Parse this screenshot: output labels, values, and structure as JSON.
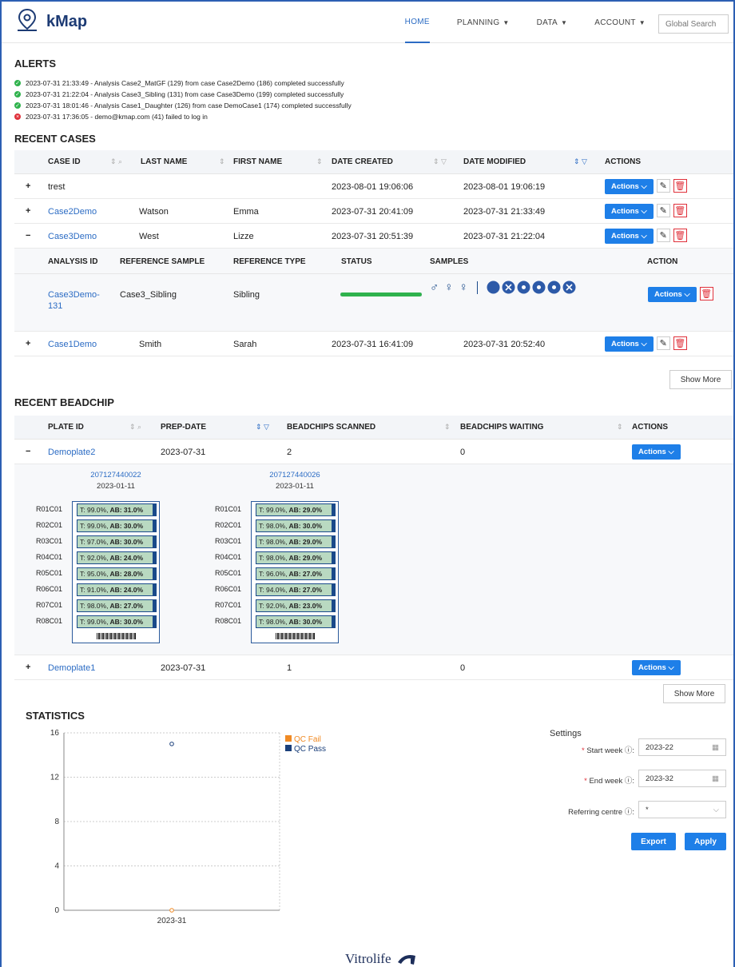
{
  "nav": {
    "app_name": "kMap",
    "links": [
      {
        "label": "HOME",
        "active": true,
        "dropdown": false
      },
      {
        "label": "PLANNING",
        "active": false,
        "dropdown": true
      },
      {
        "label": "DATA",
        "active": false,
        "dropdown": true
      },
      {
        "label": "ACCOUNT",
        "active": false,
        "dropdown": true
      }
    ],
    "search_placeholder": "Global Search"
  },
  "alerts": {
    "title": "ALERTS",
    "items": [
      {
        "status": "success",
        "text": "2023-07-31 21:33:49 - Analysis Case2_MatGF (129) from case Case2Demo (186) completed successfully"
      },
      {
        "status": "success",
        "text": "2023-07-31 21:22:04 - Analysis Case3_Sibling (131) from case Case3Demo (199) completed successfully"
      },
      {
        "status": "success",
        "text": "2023-07-31 18:01:46 - Analysis Case1_Daughter (126) from case DemoCase1 (174) completed successfully"
      },
      {
        "status": "error",
        "text": "2023-07-31 17:36:05 - demo@kmap.com (41) failed to log in"
      }
    ]
  },
  "recent_cases": {
    "title": "RECENT CASES",
    "headers": [
      "CASE ID",
      "LAST NAME",
      "FIRST NAME",
      "DATE CREATED",
      "DATE MODIFIED",
      "ACTIONS"
    ],
    "rows": [
      {
        "toggle": "+",
        "case_id": "trest",
        "last": "",
        "first": "",
        "created": "2023-08-01 19:06:06",
        "modified": "2023-08-01 19:06:19"
      },
      {
        "toggle": "+",
        "case_id": "Case2Demo",
        "last": "Watson",
        "first": "Emma",
        "created": "2023-07-31 20:41:09",
        "modified": "2023-07-31 21:33:49"
      },
      {
        "toggle": "−",
        "case_id": "Case3Demo",
        "last": "West",
        "first": "Lizze",
        "created": "2023-07-31 20:51:39",
        "modified": "2023-07-31 21:22:04"
      },
      {
        "toggle": "+",
        "case_id": "Case1Demo",
        "last": "Smith",
        "first": "Sarah",
        "created": "2023-07-31 16:41:09",
        "modified": "2023-07-31 20:52:40"
      }
    ],
    "actions_label": "Actions",
    "sub": {
      "headers": [
        "ANALYSIS ID",
        "REFERENCE SAMPLE",
        "REFERENCE TYPE",
        "STATUS",
        "SAMPLES",
        "ACTION"
      ],
      "row": {
        "analysis_id_1": "Case3Demo-",
        "analysis_id_2": "131",
        "ref_sample": "Case3_Sibling",
        "ref_type": "Sibling",
        "progress": 1.0
      }
    },
    "show_more": "Show More"
  },
  "recent_beadchip": {
    "title": "RECENT BEADCHIP",
    "headers": [
      "PLATE ID",
      "PREP-DATE",
      "BEADCHIPS SCANNED",
      "BEADCHIPS WAITING",
      "ACTIONS"
    ],
    "rows": [
      {
        "toggle": "−",
        "plate_id": "Demoplate2",
        "prep": "2023-07-31",
        "scanned": "2",
        "waiting": "0"
      },
      {
        "toggle": "+",
        "plate_id": "Demoplate1",
        "prep": "2023-07-31",
        "scanned": "1",
        "waiting": "0"
      }
    ],
    "chips": [
      {
        "id": "207127440022",
        "date": "2023-01-11",
        "rows": [
          {
            "label": "R01C01",
            "t": "T: 99.0%,",
            "ab": "AB: 31.0%"
          },
          {
            "label": "R02C01",
            "t": "T: 99.0%,",
            "ab": "AB: 30.0%"
          },
          {
            "label": "R03C01",
            "t": "T: 97.0%,",
            "ab": "AB: 30.0%"
          },
          {
            "label": "R04C01",
            "t": "T: 92.0%,",
            "ab": "AB: 24.0%"
          },
          {
            "label": "R05C01",
            "t": "T: 95.0%,",
            "ab": "AB: 28.0%"
          },
          {
            "label": "R06C01",
            "t": "T: 91.0%,",
            "ab": "AB: 24.0%"
          },
          {
            "label": "R07C01",
            "t": "T: 98.0%,",
            "ab": "AB: 27.0%"
          },
          {
            "label": "R08C01",
            "t": "T: 99.0%,",
            "ab": "AB: 30.0%"
          }
        ]
      },
      {
        "id": "207127440026",
        "date": "2023-01-11",
        "rows": [
          {
            "label": "R01C01",
            "t": "T: 99.0%,",
            "ab": "AB: 29.0%"
          },
          {
            "label": "R02C01",
            "t": "T: 98.0%,",
            "ab": "AB: 30.0%"
          },
          {
            "label": "R03C01",
            "t": "T: 98.0%,",
            "ab": "AB: 29.0%"
          },
          {
            "label": "R04C01",
            "t": "T: 98.0%,",
            "ab": "AB: 29.0%"
          },
          {
            "label": "R05C01",
            "t": "T: 96.0%,",
            "ab": "AB: 27.0%"
          },
          {
            "label": "R06C01",
            "t": "T: 94.0%,",
            "ab": "AB: 27.0%"
          },
          {
            "label": "R07C01",
            "t": "T: 92.0%,",
            "ab": "AB: 23.0%"
          },
          {
            "label": "R08C01",
            "t": "T: 98.0%,",
            "ab": "AB: 30.0%"
          }
        ]
      }
    ],
    "actions_label": "Actions",
    "show_more": "Show More"
  },
  "statistics": {
    "title": "STATISTICS",
    "settings": {
      "title": "Settings",
      "start_week_label": "Start week",
      "start_week": "2023-22",
      "end_week_label": "End week",
      "end_week": "2023-32",
      "centre_label": "Referring centre",
      "centre": "*",
      "export": "Export",
      "apply": "Apply"
    }
  },
  "chart_data": {
    "type": "scatter",
    "categories": [
      "2023-31"
    ],
    "series": [
      {
        "name": "QC Fail",
        "color": "#f08a24",
        "values": [
          0
        ]
      },
      {
        "name": "QC Pass",
        "color": "#1a3f7a",
        "values": [
          15
        ]
      }
    ],
    "yticks": [
      0,
      4,
      8,
      12,
      16
    ],
    "ylim": [
      0,
      16
    ],
    "grid": true,
    "legend": "top-right"
  },
  "footer": {
    "brand": "Vitrolife"
  },
  "colors": {
    "accent": "#1e7fe8",
    "brand": "#1d3b74",
    "success": "#2fb24c",
    "error": "#e0303a"
  }
}
